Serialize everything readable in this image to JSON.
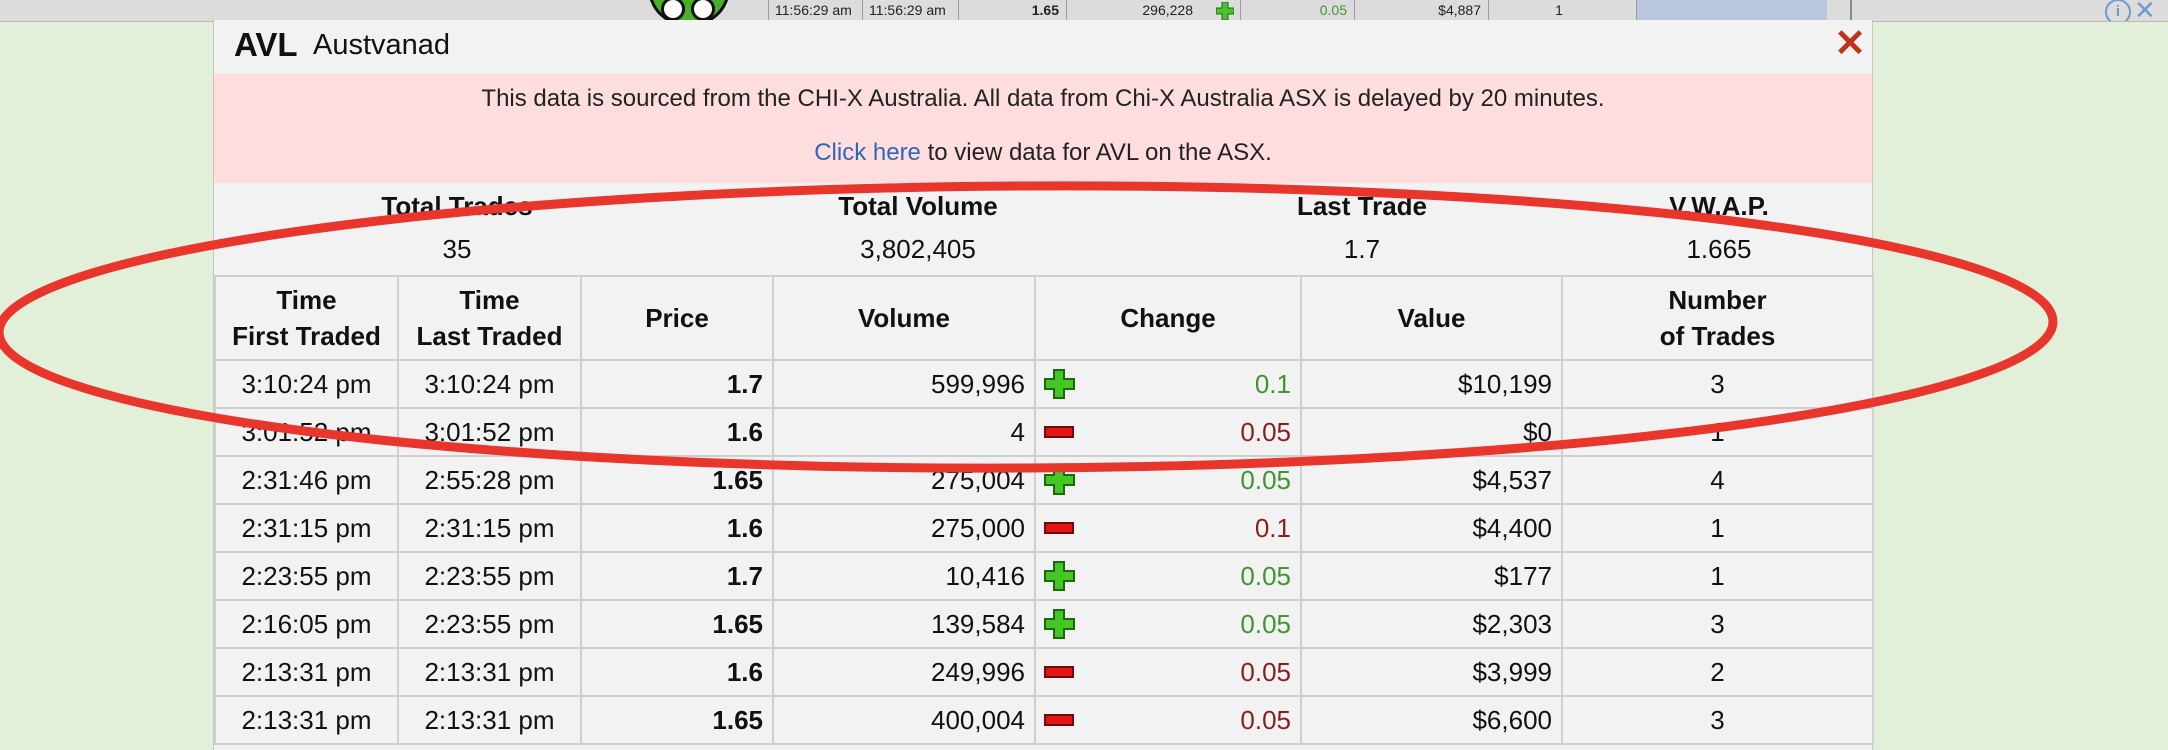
{
  "background_row": {
    "time_first": "11:56:29 am",
    "time_last": "11:56:29 am",
    "price": "1.65",
    "volume": "296,228",
    "change": "0.05",
    "value": "$4,887",
    "trades": "1"
  },
  "modal": {
    "ticker": "AVL",
    "company": "Austvanad",
    "close_icon": "close-x-icon",
    "notice_text": "This data is sourced from the CHI-X Australia. All data from Chi-X Australia ASX is delayed by 20 minutes.",
    "notice_link": "Click here",
    "notice_link_suffix": " to view data for AVL on the ASX."
  },
  "summary": [
    {
      "label": "Total Trades",
      "value": "35"
    },
    {
      "label": "Total Volume",
      "value": "3,802,405"
    },
    {
      "label": "Last Trade",
      "value": "1.7"
    },
    {
      "label": "V.W.A.P.",
      "value": "1.665"
    }
  ],
  "columns": [
    "Time First Traded",
    "Time Last Traded",
    "Price",
    "Volume",
    "Change",
    "Value",
    "Number of Trades"
  ],
  "rows": [
    {
      "first": "3:10:24 pm",
      "last": "3:10:24 pm",
      "price": "1.7",
      "volume": "599,996",
      "dir": "up",
      "change": "0.1",
      "value": "$10,199",
      "trades": "3"
    },
    {
      "first": "3:01:52 pm",
      "last": "3:01:52 pm",
      "price": "1.6",
      "volume": "4",
      "dir": "down",
      "change": "0.05",
      "value": "$0",
      "trades": "1"
    },
    {
      "first": "2:31:46 pm",
      "last": "2:55:28 pm",
      "price": "1.65",
      "volume": "275,004",
      "dir": "up",
      "change": "0.05",
      "value": "$4,537",
      "trades": "4"
    },
    {
      "first": "2:31:15 pm",
      "last": "2:31:15 pm",
      "price": "1.6",
      "volume": "275,000",
      "dir": "down",
      "change": "0.1",
      "value": "$4,400",
      "trades": "1"
    },
    {
      "first": "2:23:55 pm",
      "last": "2:23:55 pm",
      "price": "1.7",
      "volume": "10,416",
      "dir": "up",
      "change": "0.05",
      "value": "$177",
      "trades": "1"
    },
    {
      "first": "2:16:05 pm",
      "last": "2:23:55 pm",
      "price": "1.65",
      "volume": "139,584",
      "dir": "up",
      "change": "0.05",
      "value": "$2,303",
      "trades": "3"
    },
    {
      "first": "2:13:31 pm",
      "last": "2:13:31 pm",
      "price": "1.6",
      "volume": "249,996",
      "dir": "down",
      "change": "0.05",
      "value": "$3,999",
      "trades": "2"
    },
    {
      "first": "2:13:31 pm",
      "last": "2:13:31 pm",
      "price": "1.65",
      "volume": "400,004",
      "dir": "down",
      "change": "0.05",
      "value": "$6,600",
      "trades": "3"
    }
  ],
  "colors": {
    "up": "#3f962b",
    "down": "#8b1e1e",
    "notice_bg": "#fddddd",
    "annotation": "#e8362d",
    "link": "#2f67b7"
  },
  "icons": {
    "up": "plus-icon",
    "down": "minus-icon"
  }
}
